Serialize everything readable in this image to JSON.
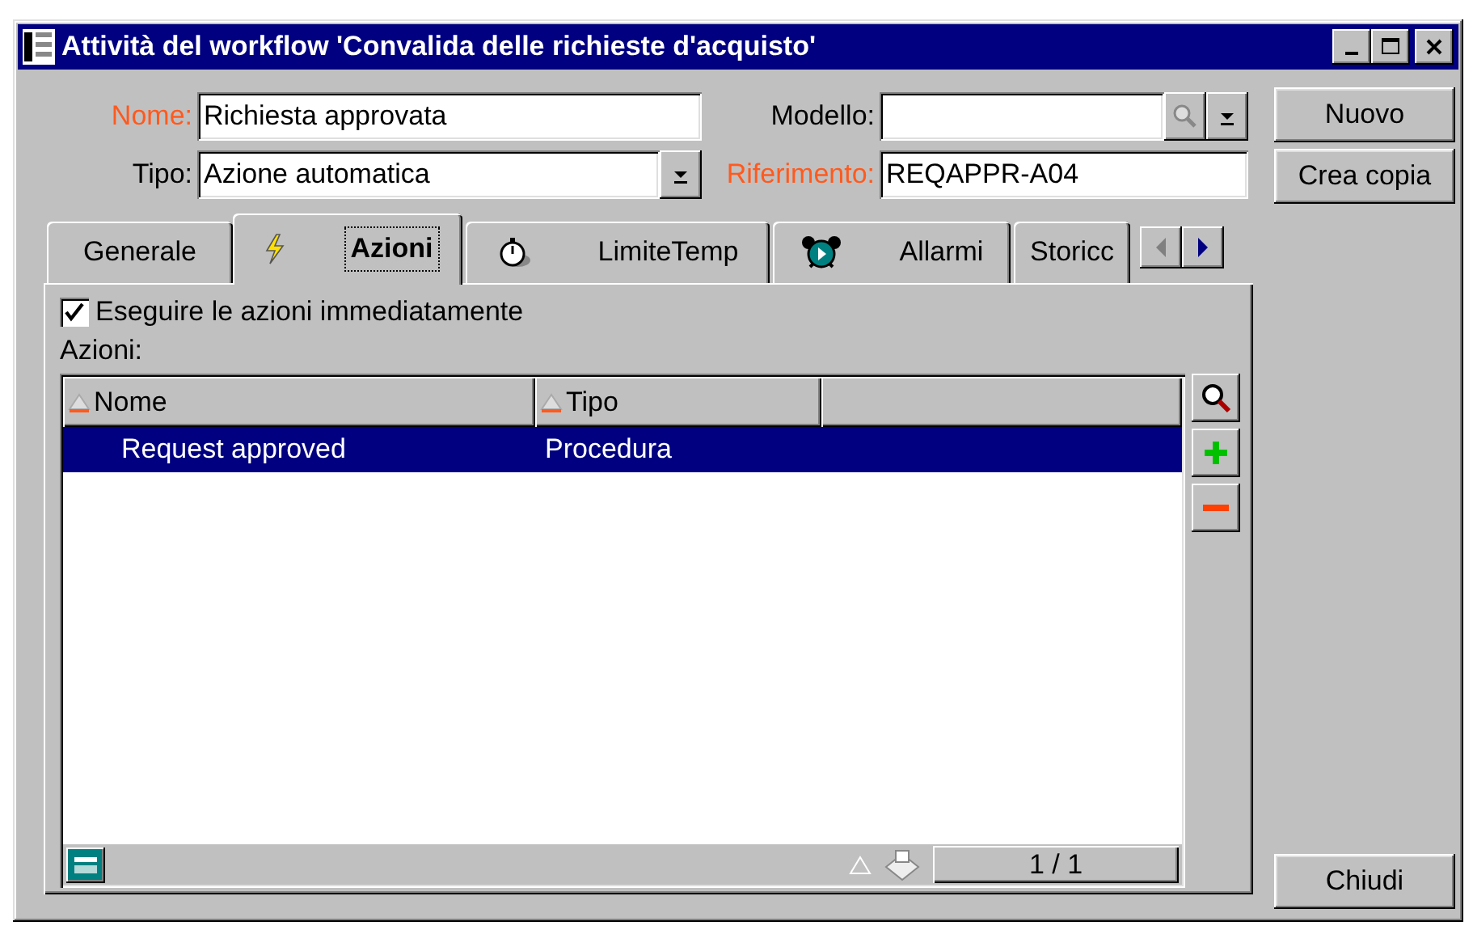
{
  "window": {
    "title": "Attività del workflow 'Convalida delle richieste d'acquisto'"
  },
  "fields": [
    {
      "label": "Nome:",
      "value": "Richiesta approvata",
      "mandatory": true,
      "kind": "text"
    },
    {
      "label": "Modello:",
      "mandatory": false,
      "kind": "lookup"
    },
    {
      "label": "Tipo:",
      "value": "Azione automatica",
      "mandatory": false,
      "kind": "combo"
    },
    {
      "label": "Riferimento:",
      "value": "REQAPPR-A04",
      "mandatory": true,
      "kind": "text"
    }
  ],
  "tabs": [
    {
      "label": "Generale",
      "selected": false
    },
    {
      "label": "Azioni",
      "selected": true
    },
    {
      "label": "LimiteTemp",
      "selected": false
    },
    {
      "label": "Allarmi",
      "selected": false
    },
    {
      "label": "Storicc",
      "selected": false
    }
  ],
  "checkbox": {
    "label": "Eseguire le azioni immediatamente",
    "checked": true
  },
  "list": {
    "label": "Azioni:",
    "columns": [
      "Nome",
      "Tipo"
    ],
    "rows": [
      {
        "cells": [
          "Request approved",
          "Procedura"
        ],
        "selected": true
      }
    ],
    "pager": "1 / 1"
  },
  "buttons": [
    "Nuovo",
    "Crea copia"
  ],
  "close_button": "Chiudi"
}
